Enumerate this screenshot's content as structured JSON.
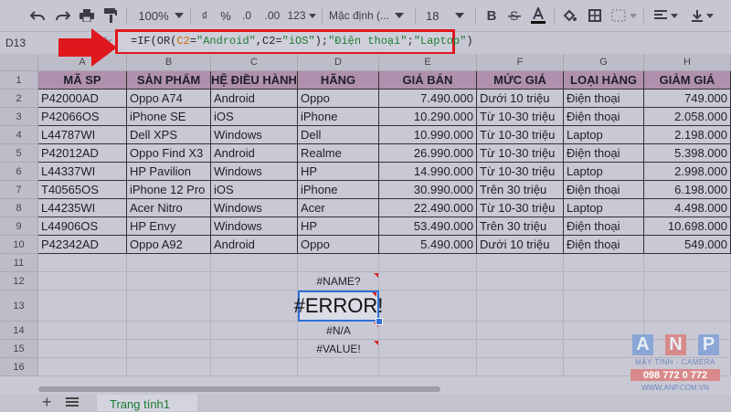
{
  "toolbar": {
    "zoom": "100%",
    "currency": "₫",
    "percent": "%",
    "dec_decrease": ".0",
    "dec_increase": ".00",
    "more_formats": "123",
    "font": "Mặc định (...",
    "font_size": "18",
    "bold": "B"
  },
  "formula_bar": {
    "name_box": "D13",
    "fx": "fx",
    "formula": {
      "p1": "=IF(OR(",
      "p2": "C2",
      "p3": "=",
      "p4": "\"Android\"",
      "p5": ",C2=",
      "p6": "\"iOS\"",
      "p7": ");",
      "p8": "\"Điện thoại\"",
      "p9": ";",
      "p10": "\"Laptop\"",
      "p11": ")"
    }
  },
  "columns": [
    "A",
    "B",
    "C",
    "D",
    "E",
    "F",
    "G",
    "H"
  ],
  "rows": [
    "1",
    "2",
    "3",
    "4",
    "5",
    "6",
    "7",
    "8",
    "9",
    "10",
    "11",
    "12",
    "13",
    "14",
    "15",
    "16"
  ],
  "table": {
    "headers": [
      "MÃ SP",
      "SẢN PHẨM",
      "HỆ ĐIỀU HÀNH",
      "HÃNG",
      "GIÁ BÁN",
      "MỨC GIÁ",
      "LOẠI HÀNG",
      "GIẢM GIÁ"
    ],
    "rows": [
      [
        "P42000AD",
        "Oppo A74",
        "Android",
        "Oppo",
        "7.490.000",
        "Dưới 10 triệu",
        "Điện thoại",
        "749.000"
      ],
      [
        "P42066OS",
        "iPhone SE",
        "iOS",
        "iPhone",
        "10.290.000",
        "Từ 10-30 triệu",
        "Điện thoại",
        "2.058.000"
      ],
      [
        "L44787WI",
        "Dell XPS",
        "Windows",
        "Dell",
        "10.990.000",
        "Từ 10-30 triệu",
        "Laptop",
        "2.198.000"
      ],
      [
        "P42012AD",
        "Oppo Find X3",
        "Android",
        "Realme",
        "26.990.000",
        "Từ 10-30 triệu",
        "Điện thoại",
        "5.398.000"
      ],
      [
        "L44337WI",
        "HP Pavilion",
        "Windows",
        "HP",
        "14.990.000",
        "Từ 10-30 triệu",
        "Laptop",
        "2.998.000"
      ],
      [
        "T40565OS",
        "iPhone 12 Pro",
        "iOS",
        "iPhone",
        "30.990.000",
        "Trên 30 triệu",
        "Điện thoại",
        "6.198.000"
      ],
      [
        "L44235WI",
        "Acer Nitro",
        "Windows",
        "Acer",
        "22.490.000",
        "Từ 10-30 triệu",
        "Laptop",
        "4.498.000"
      ],
      [
        "L44906OS",
        "HP Envy",
        "Windows",
        "HP",
        "53.490.000",
        "Trên 30 triệu",
        "Điện thoại",
        "10.698.000"
      ],
      [
        "P42342AD",
        "Oppo A92",
        "Android",
        "Oppo",
        "5.490.000",
        "Dưới 10 triệu",
        "Điện thoại",
        "549.000"
      ]
    ]
  },
  "errors": {
    "d12": "#NAME?",
    "d13": "#ERROR!",
    "d14": "#N/A",
    "d15": "#VALUE!"
  },
  "sheets": {
    "add": "+",
    "tab_label": "Trang tính1"
  },
  "logo": {
    "letters": [
      "A",
      "N",
      "P"
    ],
    "tagline": "MÁY TÍNH - CAMERA",
    "phone": "098 772 0 772",
    "website": "WWW.ANP.COM.VN"
  },
  "colors": {
    "header_fill": "#b091ad",
    "highlight_frame": "#e0171d",
    "arrow": "#e0171d",
    "selection": "#2f6fd6",
    "sheet_tab_text": "#1a7d2f"
  }
}
